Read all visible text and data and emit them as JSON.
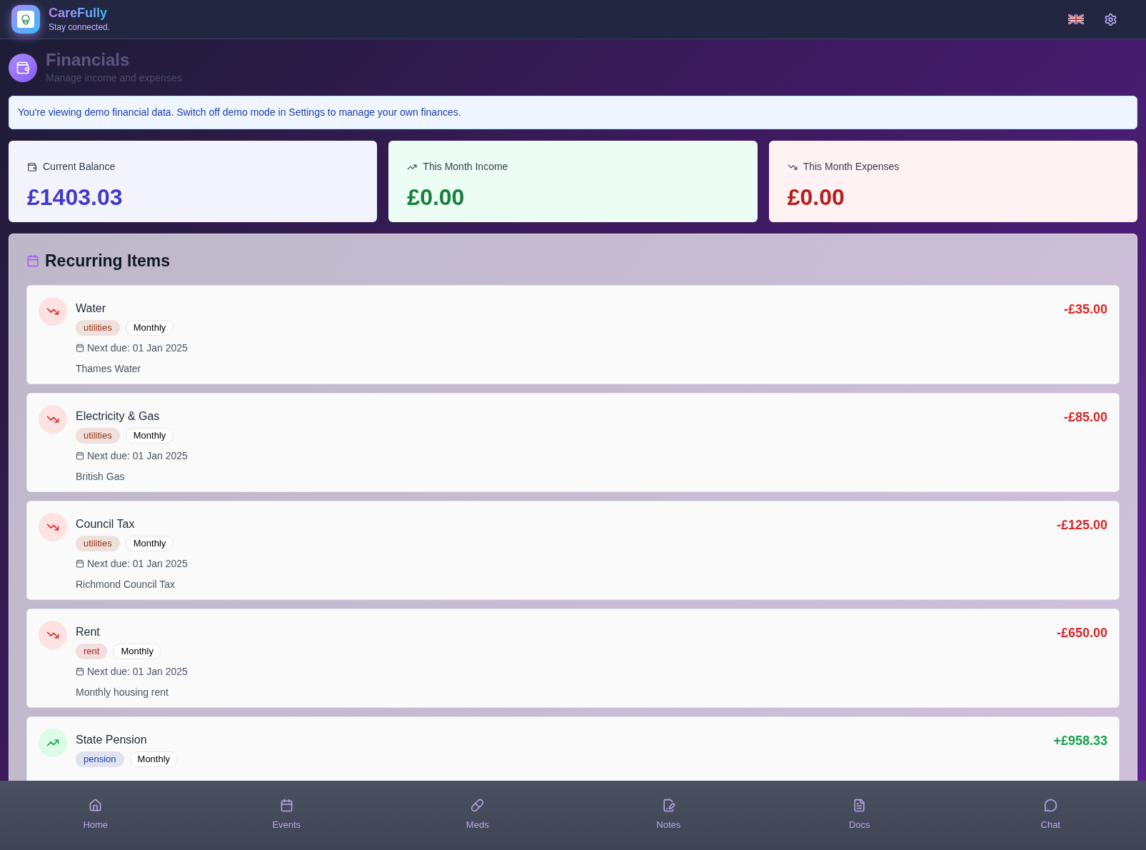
{
  "app": {
    "name": "CareFully",
    "tagline": "Stay connected."
  },
  "page": {
    "title": "Financials",
    "subtitle": "Manage income and expenses"
  },
  "notice": "You're viewing demo financial data. Switch off demo mode in Settings to manage your own finances.",
  "summary": [
    {
      "kind": "balance",
      "label": "Current Balance",
      "value": "£1403.03"
    },
    {
      "kind": "income",
      "label": "This Month Income",
      "value": "£0.00"
    },
    {
      "kind": "expense",
      "label": "This Month Expenses",
      "value": "£0.00"
    }
  ],
  "recurring": {
    "title": "Recurring Items",
    "items": [
      {
        "kind": "expense",
        "name": "Water",
        "category": "utilities",
        "color": "#9a3412",
        "frequency": "Monthly",
        "next_due": "Next due: 01 Jan 2025",
        "description": "Thames Water",
        "amount": "-£35.00"
      },
      {
        "kind": "expense",
        "name": "Electricity & Gas",
        "category": "utilities",
        "color": "#9a3412",
        "frequency": "Monthly",
        "next_due": "Next due: 01 Jan 2025",
        "description": "British Gas",
        "amount": "-£85.00"
      },
      {
        "kind": "expense",
        "name": "Council Tax",
        "category": "utilities",
        "color": "#9a3412",
        "frequency": "Monthly",
        "next_due": "Next due: 01 Jan 2025",
        "description": "Richmond Council Tax",
        "amount": "-£125.00"
      },
      {
        "kind": "expense",
        "name": "Rent",
        "category": "rent",
        "color": "#b91c1c",
        "frequency": "Monthly",
        "next_due": "Next due: 01 Jan 2025",
        "description": "Monthly housing rent",
        "amount": "-£650.00"
      },
      {
        "kind": "income",
        "name": "State Pension",
        "category": "pension",
        "color": "#1e40af",
        "frequency": "Monthly",
        "amount": "+£958.33"
      }
    ]
  },
  "nav": [
    {
      "label": "Home"
    },
    {
      "label": "Events"
    },
    {
      "label": "Meds"
    },
    {
      "label": "Notes"
    },
    {
      "label": "Docs"
    },
    {
      "label": "Chat"
    }
  ]
}
